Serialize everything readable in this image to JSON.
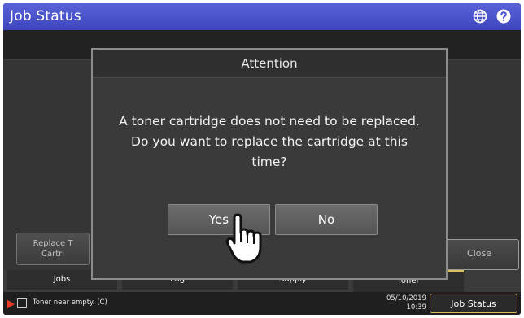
{
  "window": {
    "title": "Job Status"
  },
  "header_icons": [
    "globe-icon",
    "help-icon"
  ],
  "left_button": {
    "label_line1": "Replace T",
    "label_line2": "Cartri"
  },
  "close_button": {
    "label": "Close"
  },
  "tabs": [
    {
      "label": "Jobs"
    },
    {
      "label": "Log"
    },
    {
      "label": "Supply"
    },
    {
      "label": "Toner"
    }
  ],
  "statusbar": {
    "message": "Toner near empty. (C)",
    "date": "05/10/2019",
    "time": "10:39",
    "button_label": "Job Status"
  },
  "dialog": {
    "title": "Attention",
    "line1": "A toner cartridge does not need to be replaced.",
    "line2": "Do you want to replace the cartridge at this",
    "line3": "time?",
    "yes_label": "Yes",
    "no_label": "No"
  },
  "colors": {
    "titlebar": "#4a52cf",
    "accent": "#d9c060",
    "status_arrow": "#e83a2a"
  }
}
